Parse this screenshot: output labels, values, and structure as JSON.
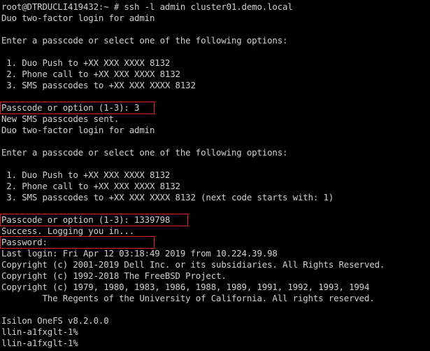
{
  "terminal": {
    "lines": [
      "root@DTRDUCLI419432:~ # ssh -l admin cluster01.demo.local",
      "Duo two-factor login for admin",
      "",
      "Enter a passcode or select one of the following options:",
      "",
      " 1. Duo Push to +XX XXX XXXX 8132",
      " 2. Phone call to +XX XXX XXXX 8132",
      " 3. SMS passcodes to +XX XXX XXXX 8132",
      "",
      "Passcode or option (1-3): 3",
      "New SMS passcodes sent.",
      "Duo two-factor login for admin",
      "",
      "Enter a passcode or select one of the following options:",
      "",
      " 1. Duo Push to +XX XXX XXXX 8132",
      " 2. Phone call to +XX XXX XXXX 8132",
      " 3. SMS passcodes to +XX XXX XXXX 8132 (next code starts with: 1)",
      "",
      "Passcode or option (1-3): 1339798",
      "Success. Logging you in...",
      "Password:",
      "Last login: Fri Apr 12 03:18:49 2019 from 10.224.39.98",
      "Copyright (c) 2001-2019 Dell Inc. or its subsidiaries. All Rights Reserved.",
      "Copyright (c) 1992-2018 The FreeBSD Project.",
      "Copyright (c) 1979, 1980, 1983, 1986, 1988, 1989, 1991, 1992, 1993, 1994",
      "        The Regents of the University of California. All rights reserved.",
      "",
      "Isilon OneFS v8.2.0.0",
      "llin-a1fxglt-1%",
      "llin-a1fxglt-1%"
    ]
  },
  "colors": {
    "background": "#000000",
    "text": "#d0d0d0",
    "highlight_border": "#e02020"
  }
}
